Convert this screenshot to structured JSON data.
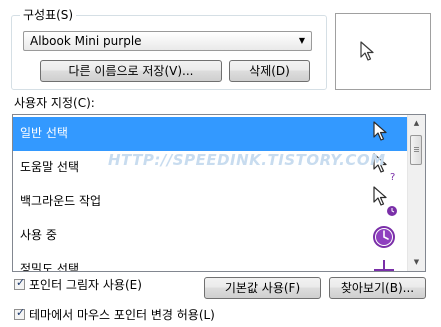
{
  "scheme": {
    "group_label": "구성표(S)",
    "selected_scheme": "Albook Mini purple",
    "save_as_label": "다른 이름으로 저장(V)...",
    "delete_label": "삭제(D)"
  },
  "customize": {
    "label": "사용자 지정(C):",
    "items": [
      {
        "label": "일반 선택",
        "icon": "arrow-pointer-icon",
        "selected": true
      },
      {
        "label": "도움말 선택",
        "icon": "help-pointer-icon",
        "selected": false
      },
      {
        "label": "백그라운드 작업",
        "icon": "working-in-background-icon",
        "selected": false
      },
      {
        "label": "사용 중",
        "icon": "busy-clock-icon",
        "selected": false
      },
      {
        "label": "정밀도 선택",
        "icon": "precision-cross-icon",
        "selected": false
      }
    ]
  },
  "watermark_text": "HTTP://SPEEDINK.TISTORY.COM",
  "options": {
    "shadow_label": "포인터 그림자 사용(E)",
    "shadow_checked": true,
    "theme_label": "테마에서 마우스 포인터 변경 허용(L)",
    "theme_checked": true
  },
  "buttons": {
    "default_label": "기본값 사용(F)",
    "browse_label": "찾아보기(B)..."
  },
  "colors": {
    "selection": "#3399ff",
    "accent_purple": "#7a2fa8"
  }
}
